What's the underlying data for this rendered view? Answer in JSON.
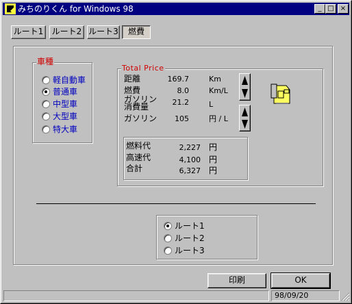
{
  "window": {
    "title": "みちのりくん for Windows 98",
    "buttons": {
      "minimize": "_",
      "maximize": "□",
      "close": "×"
    }
  },
  "tabs": [
    {
      "label": "ルート1",
      "selected": false
    },
    {
      "label": "ルート2",
      "selected": false
    },
    {
      "label": "ルート3",
      "selected": false
    },
    {
      "label": "燃費",
      "selected": true
    }
  ],
  "vehicle": {
    "legend": "車種",
    "options": [
      {
        "label": "軽自動車",
        "checked": false
      },
      {
        "label": "普通車",
        "checked": true
      },
      {
        "label": "中型車",
        "checked": false
      },
      {
        "label": "大型車",
        "checked": false
      },
      {
        "label": "特大車",
        "checked": false
      }
    ]
  },
  "total": {
    "legend": "Total Price",
    "rows": [
      {
        "label": "距離",
        "value": "169.7",
        "unit": "Km"
      },
      {
        "label": "燃費",
        "value": "8.0",
        "unit": "Km/L"
      },
      {
        "label": "ガソリン\n消費量",
        "label1": "ガソリン",
        "label2": "消費量",
        "value": "21.2",
        "unit": "L"
      },
      {
        "label": "ガソリン",
        "value": "105",
        "unit": "円 / L"
      }
    ],
    "costs": [
      {
        "label": "燃料代",
        "value": "2,227",
        "unit": "円"
      },
      {
        "label": "高速代",
        "value": "4,100",
        "unit": "円"
      },
      {
        "label": "合計",
        "value": "6,327",
        "unit": "円"
      }
    ]
  },
  "routes": {
    "options": [
      {
        "label": "ルート1",
        "checked": true
      },
      {
        "label": "ルート2",
        "checked": false
      },
      {
        "label": "ルート3",
        "checked": false
      }
    ]
  },
  "actions": {
    "print_label": "印刷",
    "ok_label": "OK"
  },
  "status": {
    "date": "98/09/20"
  },
  "colors": {
    "titlebar": "#000080",
    "legend_red": "#d00000",
    "radio_blue": "#0000c0",
    "gas_icon": "#ffff60"
  },
  "icons": {
    "app": "arrow-icon",
    "gas": "gas-pump-icon"
  }
}
